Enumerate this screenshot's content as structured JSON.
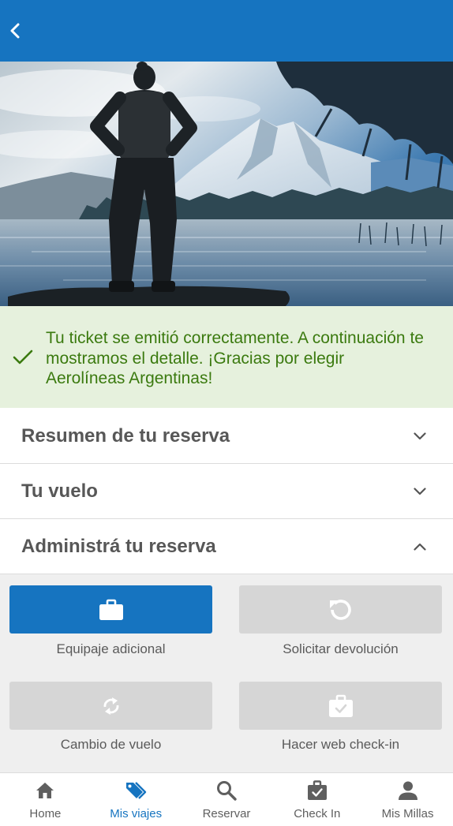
{
  "header": {
    "back_icon": "chevron-left-icon"
  },
  "banner": {
    "icon": "check-icon",
    "message": "Tu ticket se emitió correctamente. A continuación te mostramos el detalle. ¡Gracias por elegir Aerolíneas Argentinas!"
  },
  "accordion": [
    {
      "title": "Resumen de tu reserva",
      "expanded": false,
      "icon": "chevron-down-icon"
    },
    {
      "title": "Tu vuelo",
      "expanded": false,
      "icon": "chevron-down-icon"
    },
    {
      "title": "Administrá tu reserva",
      "expanded": true,
      "icon": "chevron-up-icon"
    }
  ],
  "actions": [
    {
      "label": "Equipaje adicional",
      "icon": "briefcase-icon",
      "enabled": true
    },
    {
      "label": "Solicitar devolución",
      "icon": "refund-icon",
      "enabled": false
    },
    {
      "label": "Cambio de vuelo",
      "icon": "sync-icon",
      "enabled": false
    },
    {
      "label": "Hacer web check-in",
      "icon": "briefcase-check-icon",
      "enabled": false
    }
  ],
  "nav": [
    {
      "label": "Home",
      "icon": "home-icon",
      "active": false
    },
    {
      "label": "Mis viajes",
      "icon": "tags-icon",
      "active": true
    },
    {
      "label": "Reservar",
      "icon": "search-icon",
      "active": false
    },
    {
      "label": "Check In",
      "icon": "check-in-icon",
      "active": false
    },
    {
      "label": "Mis Millas",
      "icon": "person-icon",
      "active": false
    }
  ],
  "colors": {
    "brand_blue": "#1674c0",
    "success_bg": "#e6f1dd",
    "success_text": "#3b7a0f",
    "disabled_button": "#d6d6d6",
    "nav_inactive": "#5f5f5f"
  }
}
